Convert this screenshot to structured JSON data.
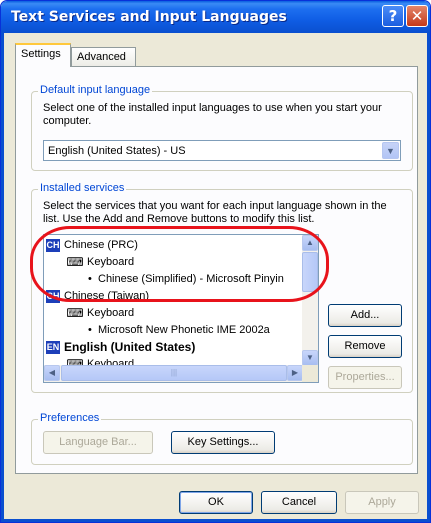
{
  "window": {
    "title": "Text Services and Input Languages",
    "help_glyph": "?",
    "close_glyph": "✕"
  },
  "tabs": [
    {
      "label": "Settings",
      "active": true
    },
    {
      "label": "Advanced",
      "active": false
    }
  ],
  "default_language": {
    "legend": "Default input language",
    "description": "Select one of the installed input languages to use when you start your computer.",
    "selected_value": "English (United States) - US"
  },
  "installed_services": {
    "legend": "Installed services",
    "description": "Select the services that you want for each input language shown in the list. Use the Add and Remove buttons to modify this list.",
    "items": [
      {
        "badge": "CH",
        "text": "Chinese (PRC)",
        "level": 0
      },
      {
        "text": "Keyboard",
        "level": 1
      },
      {
        "text": "Chinese (Simplified) - Microsoft Pinyin",
        "level": 2
      },
      {
        "badge": "CH",
        "text": "Chinese (Taiwan)",
        "level": 0
      },
      {
        "text": "Keyboard",
        "level": 1
      },
      {
        "text": "Microsoft New Phonetic IME 2002a",
        "level": 2
      },
      {
        "badge": "EN",
        "text": "English (United States)",
        "level": 0,
        "bold": true
      },
      {
        "text": "Keyboard",
        "level": 1
      }
    ],
    "buttons": {
      "add": "Add...",
      "remove": "Remove",
      "properties": "Properties..."
    }
  },
  "preferences": {
    "legend": "Preferences",
    "language_bar": "Language Bar...",
    "key_settings": "Key Settings..."
  },
  "footer": {
    "ok": "OK",
    "cancel": "Cancel",
    "apply": "Apply"
  },
  "colors": {
    "titlebar": "#0a5ee0",
    "highlight_oval": "#e8131b",
    "legend_text": "#0046d5"
  }
}
